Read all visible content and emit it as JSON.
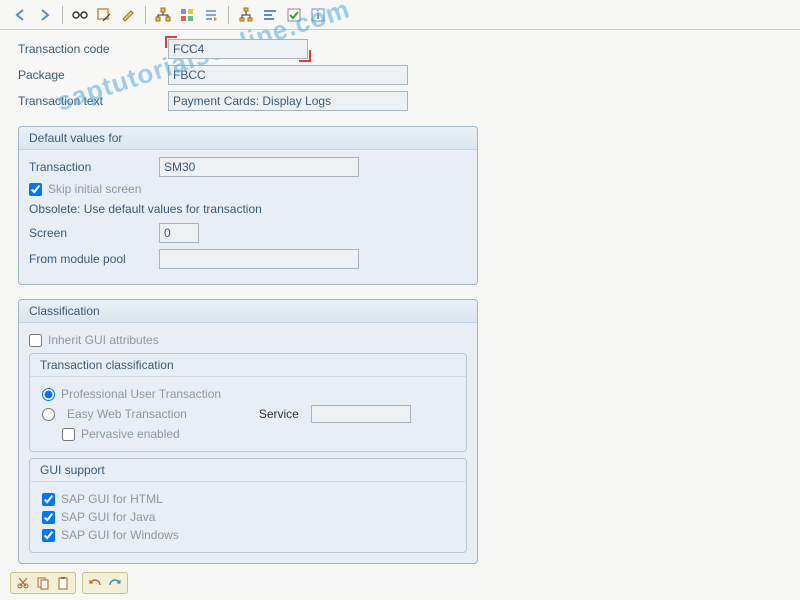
{
  "header": {
    "transaction_code_label": "Transaction code",
    "transaction_code": "FCC4",
    "package_label": "Package",
    "package": "FBCC",
    "transaction_text_label": "Transaction text",
    "transaction_text": "Payment Cards: Display Logs"
  },
  "default_values": {
    "title": "Default values for",
    "transaction_label": "Transaction",
    "transaction": "SM30",
    "skip_initial_label": "Skip initial screen",
    "skip_initial_checked": true,
    "obsolete_text": "Obsolete: Use default values for transaction",
    "screen_label": "Screen",
    "screen": "0",
    "module_pool_label": "From module pool",
    "module_pool": ""
  },
  "classification": {
    "title": "Classification",
    "inherit_label": "Inherit GUI attributes",
    "inherit_checked": false,
    "trans_class_title": "Transaction classification",
    "professional_label": "Professional User Transaction",
    "professional_selected": true,
    "easy_web_label": "Easy Web Transaction",
    "service_label": "Service",
    "service_value": "",
    "pervasive_label": "Pervasive enabled",
    "pervasive_checked": false,
    "gui_support_title": "GUI support",
    "gui_html_label": "SAP GUI for HTML",
    "gui_html_checked": true,
    "gui_java_label": "SAP GUI for Java",
    "gui_java_checked": true,
    "gui_windows_label": "SAP GUI for Windows",
    "gui_windows_checked": true
  },
  "watermark": "saptutorialsonline.com",
  "colors": {
    "accent": "#3b5a7a",
    "panel": "#e7eef5",
    "highlight": "#d94040"
  }
}
